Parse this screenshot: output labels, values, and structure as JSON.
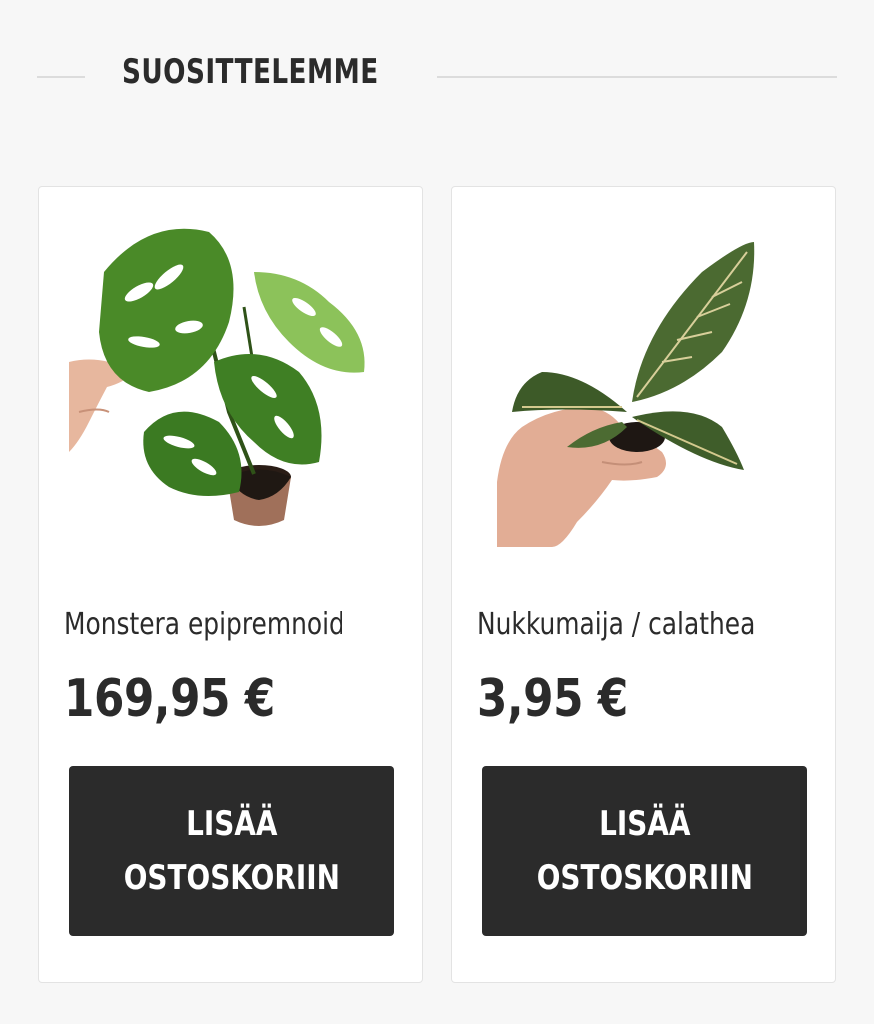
{
  "section": {
    "title": "SUOSITTELEMME"
  },
  "products": [
    {
      "name": "Monstera epipremnoide...",
      "price": "169,95 €",
      "button_label": "LISÄÄ\nOSTOSKORIIN"
    },
    {
      "name": "Nukkumaija / calathea ”...",
      "price": "3,95 €",
      "button_label": "LISÄÄ\nOSTOSKORIIN"
    }
  ],
  "colors": {
    "background": "#f7f7f7",
    "card": "#ffffff",
    "text": "#2b2b2b",
    "button": "#2b2b2b",
    "button_text": "#ffffff",
    "monstera_leaf": "#4f8a2c",
    "calathea_leaf": "#3f5a2a"
  }
}
